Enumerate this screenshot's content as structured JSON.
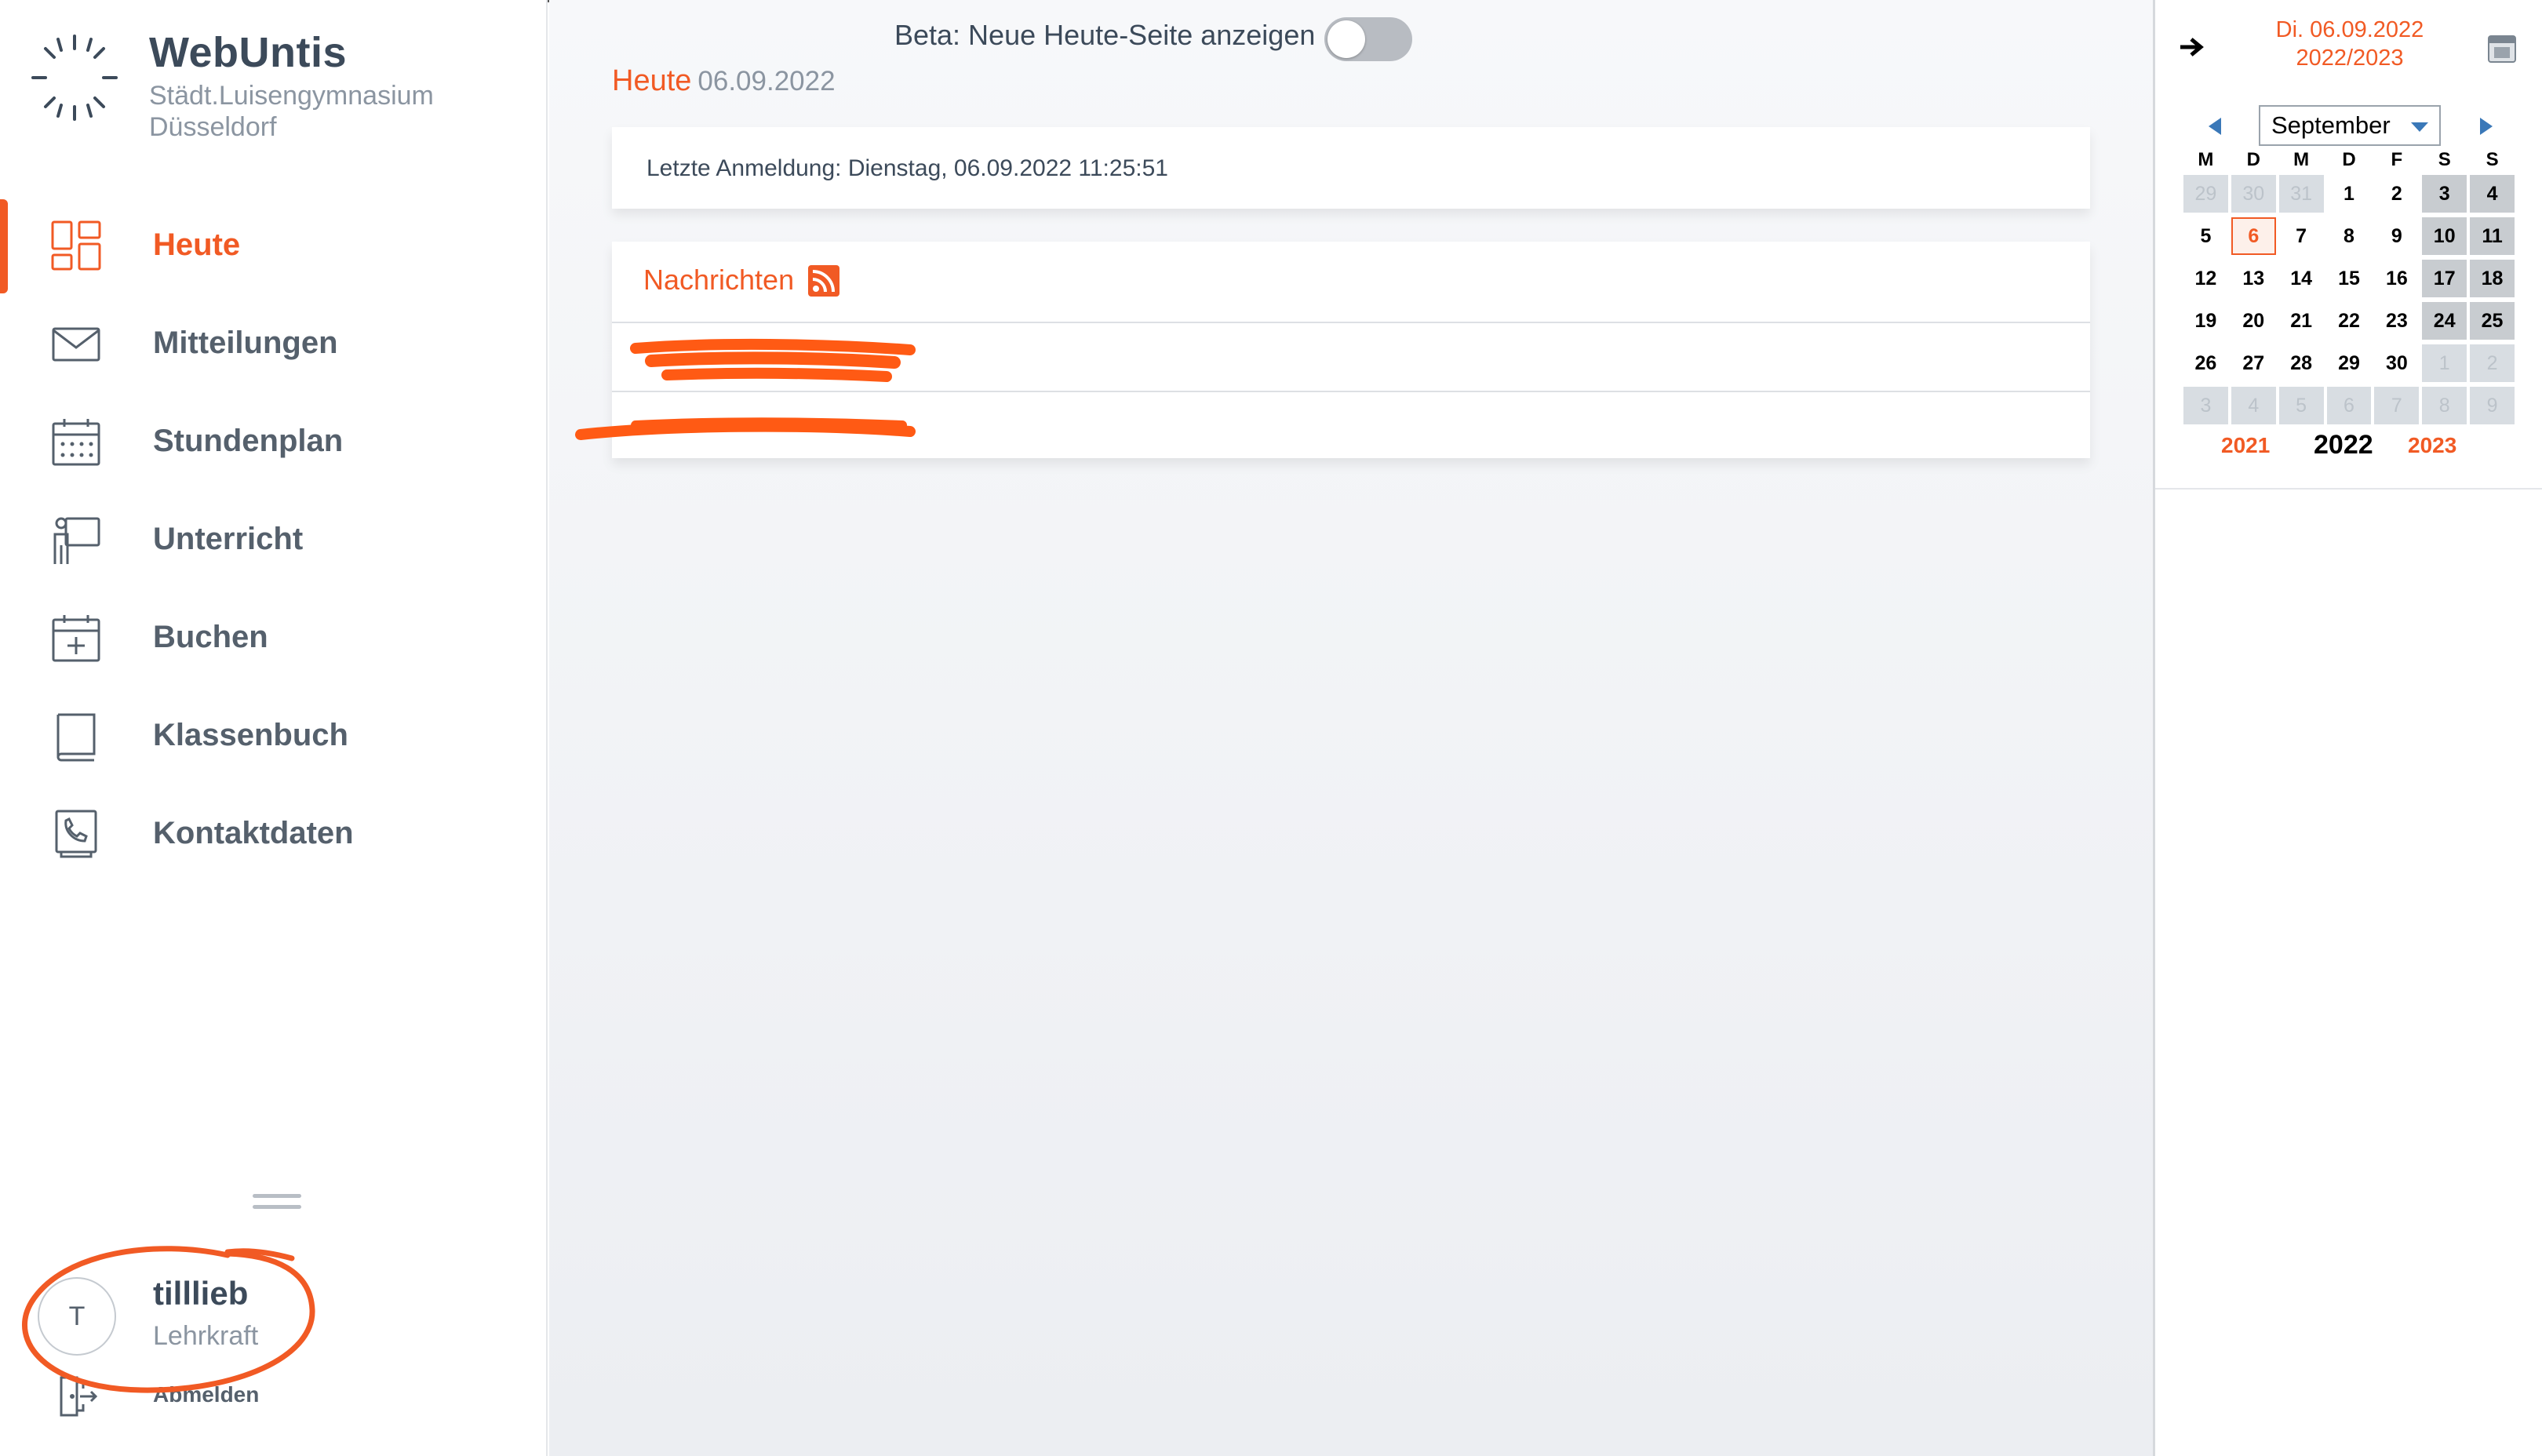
{
  "app": {
    "brand": "WebUntis",
    "school": "Städt.Luisengymnasium Düsseldorf"
  },
  "nav": {
    "items": [
      {
        "label": "Heute",
        "icon": "dashboard-icon",
        "active": true
      },
      {
        "label": "Mitteilungen",
        "icon": "envelope-icon"
      },
      {
        "label": "Stundenplan",
        "icon": "calendar-grid-icon"
      },
      {
        "label": "Unterricht",
        "icon": "teacher-board-icon"
      },
      {
        "label": "Buchen",
        "icon": "calendar-plus-icon"
      },
      {
        "label": "Klassenbuch",
        "icon": "book-icon"
      },
      {
        "label": "Kontaktdaten",
        "icon": "contact-phone-icon"
      }
    ]
  },
  "user": {
    "initial": "T",
    "name": "tilllieb",
    "role": "Lehrkraft",
    "logout_label": "Abmelden"
  },
  "main": {
    "beta_label": "Beta: Neue Heute-Seite anzeigen",
    "beta_enabled": false,
    "title": "Heute",
    "date": "06.09.2022",
    "last_login": "Letzte Anmeldung: Dienstag, 06.09.2022 11:25:51",
    "news_title": "Nachrichten"
  },
  "calendar": {
    "current_date": "Di. 06.09.2022",
    "school_year": "2022/2023",
    "month": "September",
    "weekdays": [
      "M",
      "D",
      "M",
      "D",
      "F",
      "S",
      "S"
    ],
    "weeks": [
      [
        "29",
        "30",
        "31",
        "1",
        "2",
        "3",
        "4"
      ],
      [
        "5",
        "6",
        "7",
        "8",
        "9",
        "10",
        "11"
      ],
      [
        "12",
        "13",
        "14",
        "15",
        "16",
        "17",
        "18"
      ],
      [
        "19",
        "20",
        "21",
        "22",
        "23",
        "24",
        "25"
      ],
      [
        "26",
        "27",
        "28",
        "29",
        "30",
        "1",
        "2"
      ],
      [
        "3",
        "4",
        "5",
        "6",
        "7",
        "8",
        "9"
      ]
    ],
    "years": {
      "prev": "2021",
      "current": "2022",
      "next": "2023"
    },
    "colors": {
      "accent": "#f15a24",
      "weekend": "#c8ccd0",
      "other_month": "#d8dde2"
    }
  }
}
